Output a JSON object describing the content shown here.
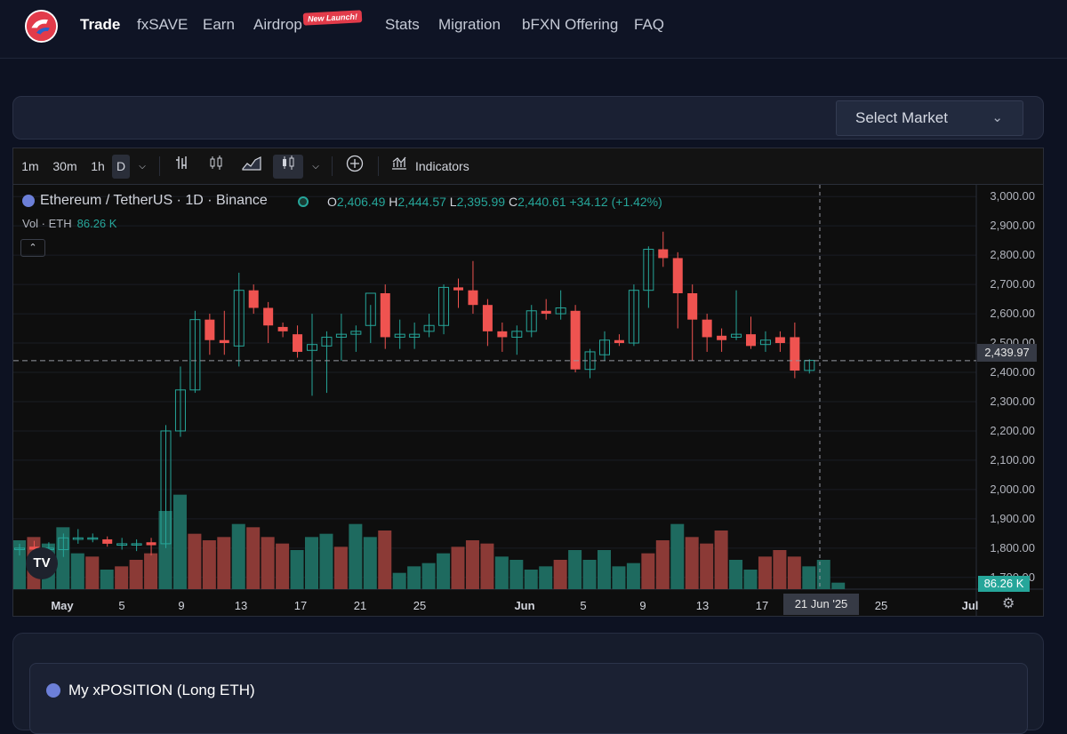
{
  "nav": {
    "items": [
      {
        "label": "Trade",
        "active": true
      },
      {
        "label": "fxSAVE"
      },
      {
        "label": "Earn"
      },
      {
        "label": "Airdrop"
      },
      {
        "label": "Stats"
      },
      {
        "label": "Migration"
      },
      {
        "label": "bFXN Offering"
      },
      {
        "label": "FAQ"
      }
    ],
    "airdrop_badge": "New Launch!"
  },
  "market": {
    "select_label": "Select Market"
  },
  "toolbar": {
    "intervals": [
      "1m",
      "30m",
      "1h",
      "D"
    ],
    "selected_interval": "D",
    "indicators_label": "Indicators"
  },
  "legend": {
    "symbol": "Ethereum / TetherUS · 1D · Binance",
    "o_label": "O",
    "o": "2,406.49",
    "h_label": "H",
    "h": "2,444.57",
    "l_label": "L",
    "l": "2,395.99",
    "c_label": "C",
    "c": "2,440.61",
    "change": "+34.12 (+1.42%)",
    "vol_label": "Vol · ETH",
    "vol_value": "86.26 K"
  },
  "crosshair": {
    "price": "2,439.97",
    "volume": "86.26 K",
    "date": "21 Jun '25"
  },
  "colors": {
    "up": "#26a69a",
    "down": "#ef5350",
    "vol_up": "#1e6a5f",
    "vol_down": "#8b3a36"
  },
  "chart_data": {
    "type": "candlestick",
    "title": "Ethereum / TetherUS · 1D · Binance",
    "y_ticks": [
      "3,000.00",
      "2,900.00",
      "2,800.00",
      "2,700.00",
      "2,600.00",
      "2,500.00",
      "2,400.00",
      "2,300.00",
      "2,200.00",
      "2,100.00",
      "2,000.00",
      "1,900.00",
      "1,800.00",
      "1,700.00"
    ],
    "x_ticks": [
      "May",
      "5",
      "9",
      "13",
      "17",
      "21",
      "25",
      "Jun",
      "5",
      "9",
      "13",
      "17",
      "21 Jun '25",
      "25",
      "Jul"
    ],
    "ylim": [
      1660,
      3040
    ],
    "candles": [
      {
        "o": 1795,
        "h": 1815,
        "l": 1775,
        "c": 1800
      },
      {
        "o": 1805,
        "h": 1825,
        "l": 1775,
        "c": 1795
      },
      {
        "o": 1795,
        "h": 1820,
        "l": 1770,
        "c": 1800
      },
      {
        "o": 1795,
        "h": 1850,
        "l": 1770,
        "c": 1835
      },
      {
        "o": 1830,
        "h": 1865,
        "l": 1815,
        "c": 1835
      },
      {
        "o": 1835,
        "h": 1850,
        "l": 1820,
        "c": 1835
      },
      {
        "o": 1830,
        "h": 1840,
        "l": 1805,
        "c": 1815
      },
      {
        "o": 1810,
        "h": 1835,
        "l": 1795,
        "c": 1815
      },
      {
        "o": 1815,
        "h": 1830,
        "l": 1790,
        "c": 1815
      },
      {
        "o": 1820,
        "h": 1835,
        "l": 1775,
        "c": 1810
      },
      {
        "o": 1815,
        "h": 2220,
        "l": 1800,
        "c": 2200
      },
      {
        "o": 2200,
        "h": 2420,
        "l": 2180,
        "c": 2340
      },
      {
        "o": 2340,
        "h": 2610,
        "l": 2330,
        "c": 2580
      },
      {
        "o": 2580,
        "h": 2600,
        "l": 2460,
        "c": 2510
      },
      {
        "o": 2510,
        "h": 2610,
        "l": 2460,
        "c": 2500
      },
      {
        "o": 2490,
        "h": 2740,
        "l": 2420,
        "c": 2680
      },
      {
        "o": 2680,
        "h": 2700,
        "l": 2600,
        "c": 2620
      },
      {
        "o": 2620,
        "h": 2640,
        "l": 2500,
        "c": 2560
      },
      {
        "o": 2555,
        "h": 2570,
        "l": 2520,
        "c": 2540
      },
      {
        "o": 2530,
        "h": 2560,
        "l": 2450,
        "c": 2470
      },
      {
        "o": 2475,
        "h": 2600,
        "l": 2320,
        "c": 2495
      },
      {
        "o": 2490,
        "h": 2540,
        "l": 2330,
        "c": 2520
      },
      {
        "o": 2520,
        "h": 2600,
        "l": 2440,
        "c": 2530
      },
      {
        "o": 2530,
        "h": 2560,
        "l": 2470,
        "c": 2540
      },
      {
        "o": 2560,
        "h": 2630,
        "l": 2500,
        "c": 2670
      },
      {
        "o": 2670,
        "h": 2700,
        "l": 2480,
        "c": 2520
      },
      {
        "o": 2520,
        "h": 2580,
        "l": 2480,
        "c": 2530
      },
      {
        "o": 2520,
        "h": 2570,
        "l": 2480,
        "c": 2530
      },
      {
        "o": 2540,
        "h": 2600,
        "l": 2520,
        "c": 2560
      },
      {
        "o": 2560,
        "h": 2700,
        "l": 2530,
        "c": 2690
      },
      {
        "o": 2690,
        "h": 2720,
        "l": 2620,
        "c": 2680
      },
      {
        "o": 2680,
        "h": 2780,
        "l": 2600,
        "c": 2630
      },
      {
        "o": 2630,
        "h": 2650,
        "l": 2490,
        "c": 2540
      },
      {
        "o": 2540,
        "h": 2570,
        "l": 2470,
        "c": 2520
      },
      {
        "o": 2520,
        "h": 2560,
        "l": 2460,
        "c": 2540
      },
      {
        "o": 2540,
        "h": 2630,
        "l": 2520,
        "c": 2610
      },
      {
        "o": 2610,
        "h": 2650,
        "l": 2580,
        "c": 2600
      },
      {
        "o": 2600,
        "h": 2680,
        "l": 2580,
        "c": 2620
      },
      {
        "o": 2610,
        "h": 2630,
        "l": 2400,
        "c": 2410
      },
      {
        "o": 2410,
        "h": 2480,
        "l": 2380,
        "c": 2470
      },
      {
        "o": 2460,
        "h": 2540,
        "l": 2440,
        "c": 2510
      },
      {
        "o": 2510,
        "h": 2530,
        "l": 2490,
        "c": 2500
      },
      {
        "o": 2500,
        "h": 2700,
        "l": 2490,
        "c": 2680
      },
      {
        "o": 2680,
        "h": 2830,
        "l": 2620,
        "c": 2820
      },
      {
        "o": 2820,
        "h": 2880,
        "l": 2760,
        "c": 2790
      },
      {
        "o": 2790,
        "h": 2810,
        "l": 2550,
        "c": 2670
      },
      {
        "o": 2670,
        "h": 2700,
        "l": 2440,
        "c": 2580
      },
      {
        "o": 2580,
        "h": 2600,
        "l": 2470,
        "c": 2520
      },
      {
        "o": 2525,
        "h": 2550,
        "l": 2470,
        "c": 2510
      },
      {
        "o": 2520,
        "h": 2680,
        "l": 2510,
        "c": 2530
      },
      {
        "o": 2530,
        "h": 2590,
        "l": 2480,
        "c": 2490
      },
      {
        "o": 2495,
        "h": 2540,
        "l": 2470,
        "c": 2510
      },
      {
        "o": 2520,
        "h": 2540,
        "l": 2470,
        "c": 2500
      },
      {
        "o": 2520,
        "h": 2570,
        "l": 2380,
        "c": 2406
      },
      {
        "o": 2406.49,
        "h": 2444.57,
        "l": 2395.99,
        "c": 2440.61
      }
    ],
    "volume": [
      30,
      32,
      28,
      38,
      22,
      20,
      12,
      14,
      18,
      22,
      48,
      58,
      34,
      30,
      32,
      40,
      38,
      32,
      28,
      24,
      32,
      34,
      26,
      40,
      32,
      36,
      10,
      14,
      16,
      22,
      26,
      30,
      28,
      20,
      18,
      12,
      14,
      18,
      24,
      18,
      24,
      14,
      16,
      22,
      30,
      40,
      32,
      28,
      36,
      18,
      12,
      20,
      24,
      20,
      14,
      18,
      4
    ],
    "volume_dir": [
      "u",
      "d",
      "u",
      "u",
      "u",
      "d",
      "u",
      "d",
      "d",
      "d",
      "u",
      "u",
      "d",
      "d",
      "d",
      "u",
      "d",
      "d",
      "d",
      "u",
      "u",
      "u",
      "d",
      "u",
      "u",
      "d",
      "u",
      "u",
      "u",
      "u",
      "d",
      "d",
      "d",
      "u",
      "u",
      "u",
      "u",
      "d",
      "u",
      "u",
      "u",
      "u",
      "u",
      "d",
      "d",
      "u",
      "d",
      "d",
      "d",
      "u",
      "u",
      "d",
      "d",
      "d",
      "u",
      "u",
      "u"
    ]
  },
  "position": {
    "title": "My xPOSITION (Long ETH)"
  }
}
